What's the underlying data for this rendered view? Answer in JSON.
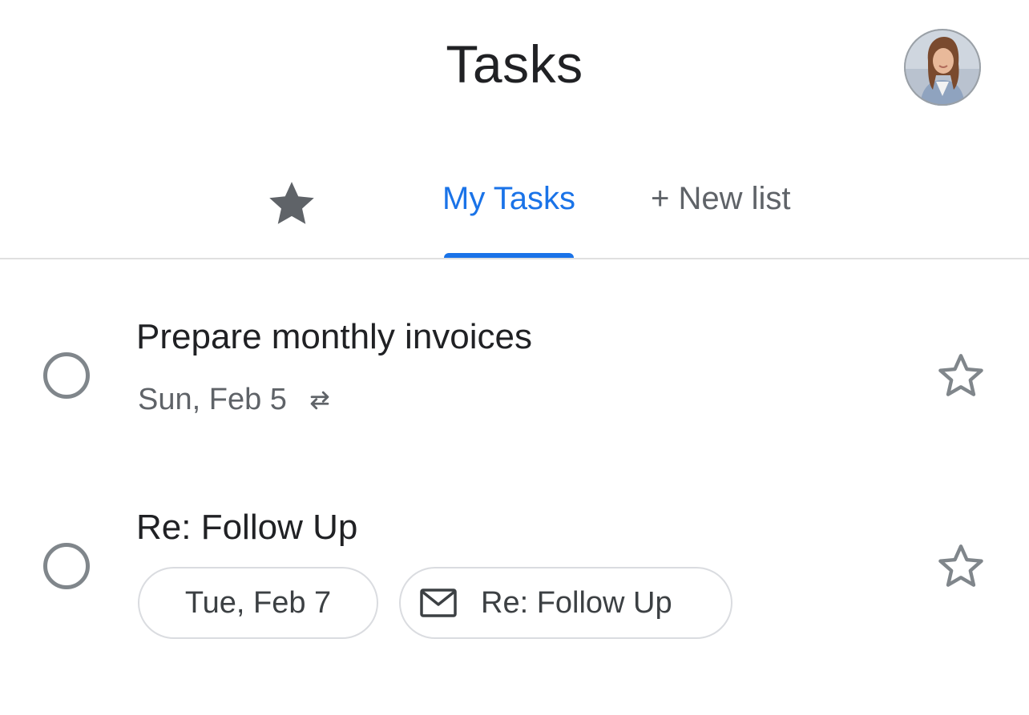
{
  "header": {
    "title": "Tasks",
    "avatar_icon": "user-avatar"
  },
  "tabs": {
    "starred_icon": "star-filled-icon",
    "active": {
      "label": "My Tasks"
    },
    "new_list": {
      "label": "+ New list"
    }
  },
  "colors": {
    "accent": "#1a73e8",
    "text_primary": "#202124",
    "text_secondary": "#5f6368",
    "icon_gray": "#80868b",
    "chip_border": "#dadce0"
  },
  "tasks": [
    {
      "title": "Prepare monthly invoices",
      "date": "Sun, Feb 5",
      "repeat_icon": "repeat-icon",
      "starred": false
    },
    {
      "title": "Re: Follow Up",
      "date_chip": "Tue, Feb 7",
      "link_chip": {
        "icon": "mail-icon",
        "label": "Re: Follow Up"
      },
      "starred": false
    }
  ]
}
